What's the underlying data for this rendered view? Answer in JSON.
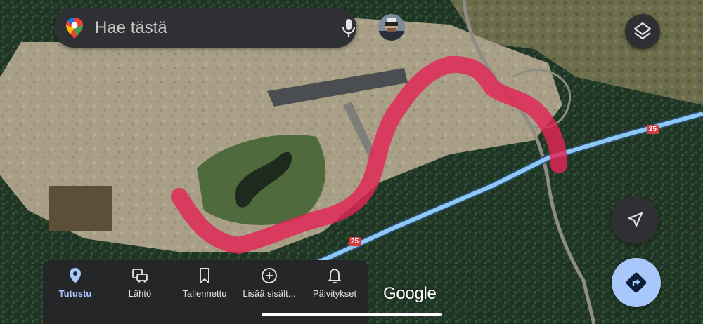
{
  "search": {
    "placeholder": "Hae tästä"
  },
  "map": {
    "route_number_label": "25",
    "watermark": "Google",
    "route_color": "#e32456",
    "road_color": "#8ec8f5"
  },
  "nav": {
    "items": [
      {
        "label": "Tutustu",
        "icon": "location-pin-icon",
        "active": true
      },
      {
        "label": "Lähtö",
        "icon": "commute-icon",
        "active": false
      },
      {
        "label": "Tallennettu",
        "icon": "bookmark-icon",
        "active": false
      },
      {
        "label": "Lisää sisält...",
        "icon": "add-circle-icon",
        "active": false
      },
      {
        "label": "Päivitykset",
        "icon": "bell-icon",
        "active": false
      }
    ]
  },
  "buttons": {
    "layers_icon": "layers-icon",
    "locate_icon": "navigation-arrow-icon",
    "directions_icon": "directions-icon",
    "directions_color": "#a8c7fa"
  }
}
